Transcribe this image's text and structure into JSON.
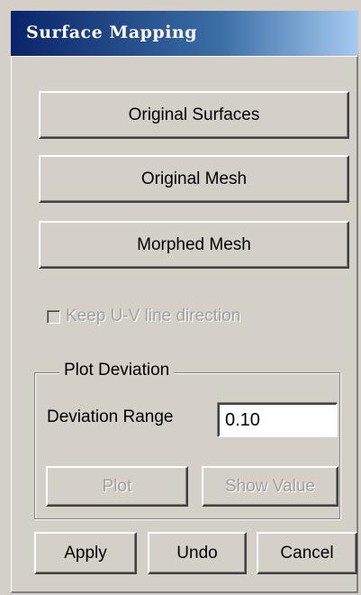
{
  "window": {
    "title": "Surface Mapping"
  },
  "buttons": {
    "original_surfaces": "Original Surfaces",
    "original_mesh": "Original Mesh",
    "morphed_mesh": "Morphed Mesh"
  },
  "options": {
    "keep_uv_label": "Keep U-V  line direction",
    "keep_uv_checked": false,
    "keep_uv_enabled": false
  },
  "plot_deviation": {
    "group_label": "Plot Deviation",
    "range_label": "Deviation Range",
    "range_value": "0.10",
    "plot_label": "Plot",
    "show_value_label": "Show Value"
  },
  "footer": {
    "apply_label": "Apply",
    "undo_label": "Undo",
    "cancel_label": "Cancel"
  },
  "colors": {
    "face": "#d4d0c8",
    "title_start": "#0a246a",
    "title_end": "#a6caf0",
    "disabled_text": "#a0a0a0"
  }
}
